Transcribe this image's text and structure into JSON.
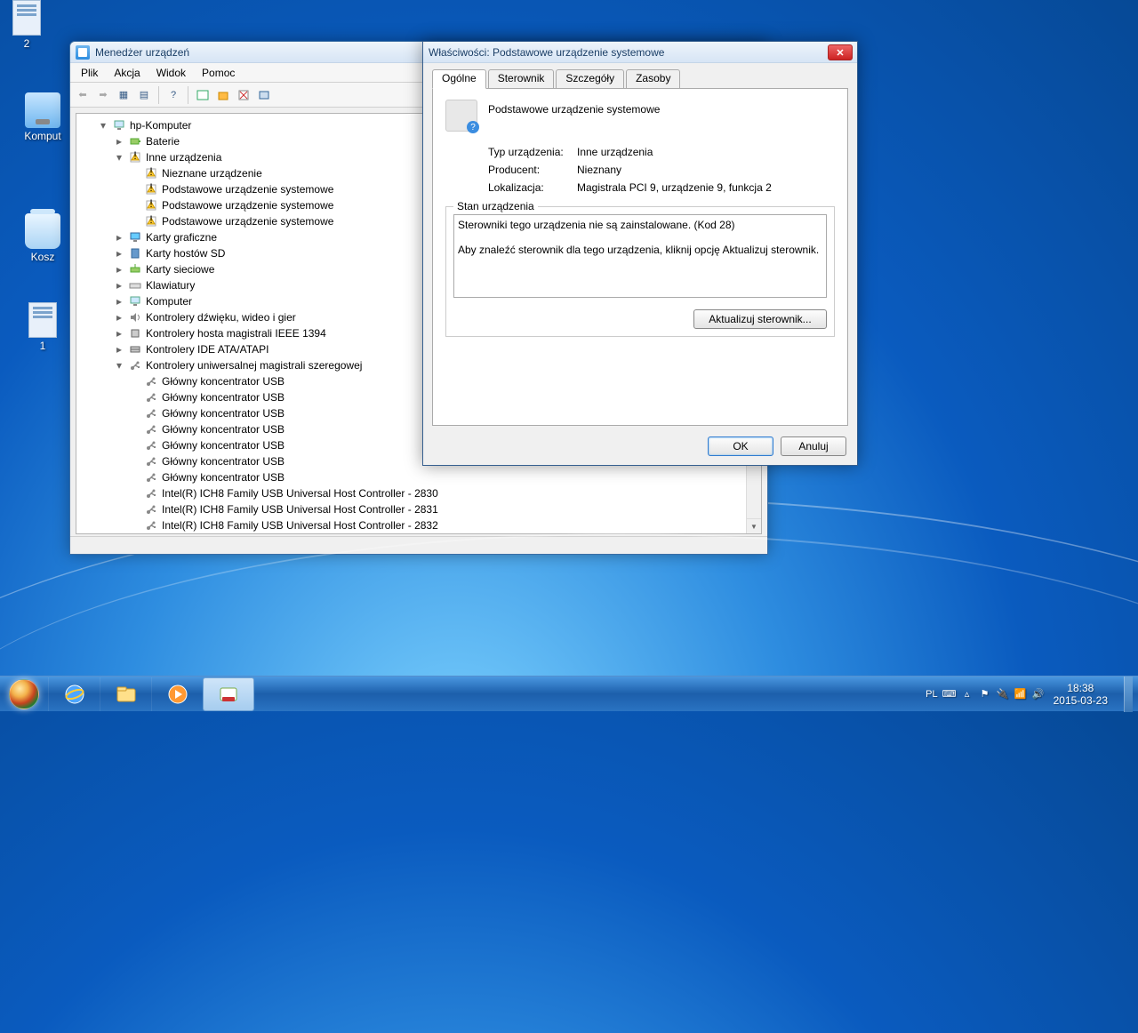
{
  "desktop": {
    "icons": [
      "Komput",
      "Kosz",
      "1",
      "2"
    ]
  },
  "devmgr": {
    "title": "Menedżer urządzeń",
    "menu": [
      "Plik",
      "Akcja",
      "Widok",
      "Pomoc"
    ],
    "root": "hp-Komputer",
    "tree": [
      {
        "indent": 1,
        "exp": "▾",
        "icon": "computer",
        "label": "hp-Komputer"
      },
      {
        "indent": 2,
        "exp": "▸",
        "icon": "battery",
        "label": "Baterie"
      },
      {
        "indent": 2,
        "exp": "▾",
        "icon": "warn",
        "label": "Inne urządzenia"
      },
      {
        "indent": 3,
        "exp": "",
        "icon": "warn",
        "label": "Nieznane urządzenie"
      },
      {
        "indent": 3,
        "exp": "",
        "icon": "warn",
        "label": "Podstawowe urządzenie systemowe"
      },
      {
        "indent": 3,
        "exp": "",
        "icon": "warn",
        "label": "Podstawowe urządzenie systemowe"
      },
      {
        "indent": 3,
        "exp": "",
        "icon": "warn",
        "label": "Podstawowe urządzenie systemowe"
      },
      {
        "indent": 2,
        "exp": "▸",
        "icon": "display",
        "label": "Karty graficzne"
      },
      {
        "indent": 2,
        "exp": "▸",
        "icon": "sd",
        "label": "Karty hostów SD"
      },
      {
        "indent": 2,
        "exp": "▸",
        "icon": "net",
        "label": "Karty sieciowe"
      },
      {
        "indent": 2,
        "exp": "▸",
        "icon": "kbd",
        "label": "Klawiatury"
      },
      {
        "indent": 2,
        "exp": "▸",
        "icon": "computer",
        "label": "Komputer"
      },
      {
        "indent": 2,
        "exp": "▸",
        "icon": "sound",
        "label": "Kontrolery dźwięku, wideo i gier"
      },
      {
        "indent": 2,
        "exp": "▸",
        "icon": "ieee",
        "label": "Kontrolery hosta magistrali IEEE 1394"
      },
      {
        "indent": 2,
        "exp": "▸",
        "icon": "ide",
        "label": "Kontrolery IDE ATA/ATAPI"
      },
      {
        "indent": 2,
        "exp": "▾",
        "icon": "usb",
        "label": "Kontrolery uniwersalnej magistrali szeregowej"
      },
      {
        "indent": 3,
        "exp": "",
        "icon": "usb",
        "label": "Główny koncentrator USB"
      },
      {
        "indent": 3,
        "exp": "",
        "icon": "usb",
        "label": "Główny koncentrator USB"
      },
      {
        "indent": 3,
        "exp": "",
        "icon": "usb",
        "label": "Główny koncentrator USB"
      },
      {
        "indent": 3,
        "exp": "",
        "icon": "usb",
        "label": "Główny koncentrator USB"
      },
      {
        "indent": 3,
        "exp": "",
        "icon": "usb",
        "label": "Główny koncentrator USB"
      },
      {
        "indent": 3,
        "exp": "",
        "icon": "usb",
        "label": "Główny koncentrator USB"
      },
      {
        "indent": 3,
        "exp": "",
        "icon": "usb",
        "label": "Główny koncentrator USB"
      },
      {
        "indent": 3,
        "exp": "",
        "icon": "usb",
        "label": "Intel(R) ICH8 Family USB Universal Host Controller - 2830"
      },
      {
        "indent": 3,
        "exp": "",
        "icon": "usb",
        "label": "Intel(R) ICH8 Family USB Universal Host Controller - 2831"
      },
      {
        "indent": 3,
        "exp": "",
        "icon": "usb",
        "label": "Intel(R) ICH8 Family USB Universal Host Controller - 2832"
      }
    ]
  },
  "props": {
    "title": "Właściwości: Podstawowe urządzenie systemowe",
    "tabs": [
      "Ogólne",
      "Sterownik",
      "Szczegóły",
      "Zasoby"
    ],
    "devname": "Podstawowe urządzenie systemowe",
    "rows": {
      "type_k": "Typ urządzenia:",
      "type_v": "Inne urządzenia",
      "vendor_k": "Producent:",
      "vendor_v": "Nieznany",
      "loc_k": "Lokalizacja:",
      "loc_v": "Magistrala PCI 9, urządzenie 9, funkcja 2"
    },
    "status_legend": "Stan urządzenia",
    "status_text": "Sterowniki tego urządzenia nie są zainstalowane. (Kod 28)\n\nAby znaleźć sterownik dla tego urządzenia, kliknij opcję Aktualizuj sterownik.",
    "update_btn": "Aktualizuj sterownik...",
    "ok": "OK",
    "cancel": "Anuluj"
  },
  "taskbar": {
    "lang": "PL",
    "time": "18:38",
    "date": "2015-03-23"
  }
}
